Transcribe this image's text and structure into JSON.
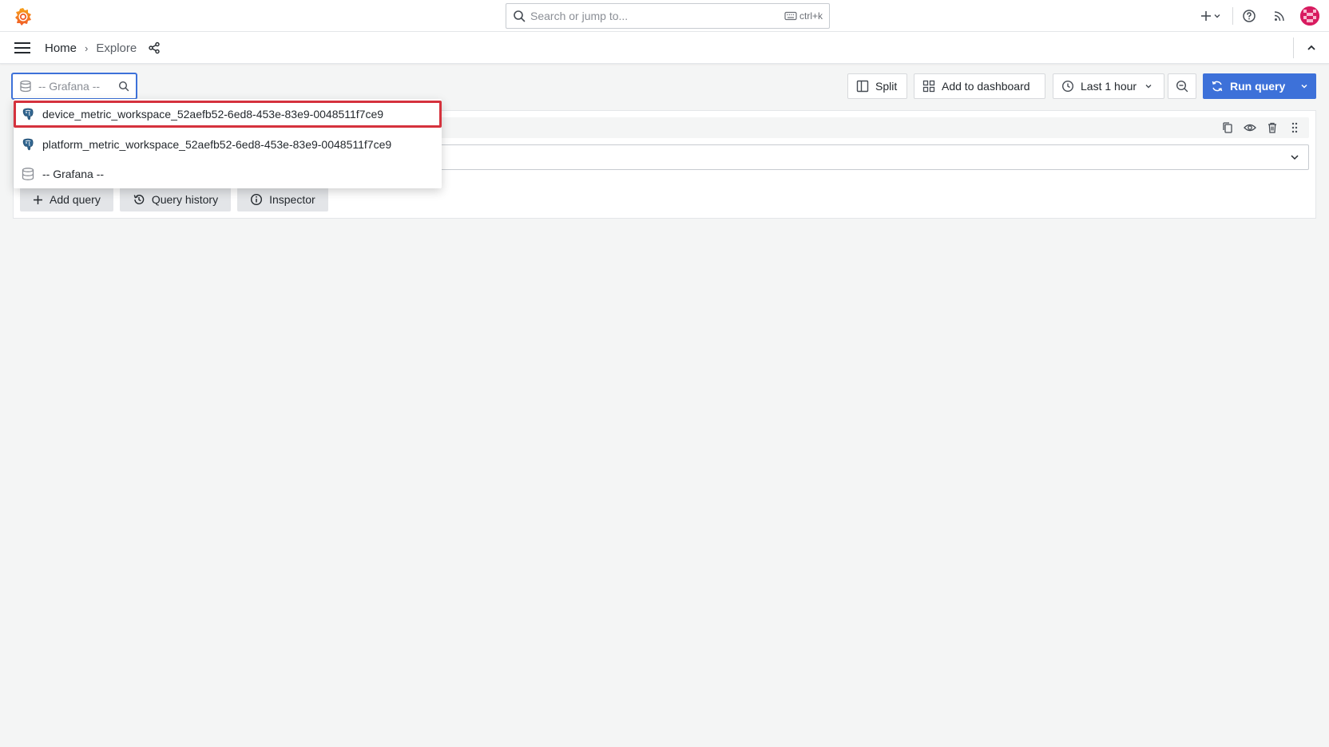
{
  "topbar": {
    "search_placeholder": "Search or jump to...",
    "search_shortcut": "ctrl+k"
  },
  "navbar": {
    "breadcrumbs": [
      {
        "label": "Home"
      },
      {
        "label": "Explore"
      }
    ],
    "separator": "›"
  },
  "toolbar": {
    "datasource_placeholder": "-- Grafana --",
    "split_label": "Split",
    "add_to_dashboard_label": "Add to dashboard",
    "time_range_label": "Last 1 hour",
    "run_query_label": "Run query"
  },
  "query_panel": {
    "add_query_label": "Add query",
    "query_history_label": "Query history",
    "inspector_label": "Inspector"
  },
  "datasource_dropdown": {
    "options": [
      {
        "label": "device_metric_workspace_52aefb52-6ed8-453e-83e9-0048511f7ce9",
        "icon": "postgresql-icon"
      },
      {
        "label": "platform_metric_workspace_52aefb52-6ed8-453e-83e9-0048511f7ce9",
        "icon": "postgresql-icon"
      },
      {
        "label": "-- Grafana --",
        "icon": "database-icon"
      }
    ]
  },
  "colors": {
    "accent": "#3d71d9",
    "highlight": "#d5323d",
    "avatar": "#d81b60"
  }
}
